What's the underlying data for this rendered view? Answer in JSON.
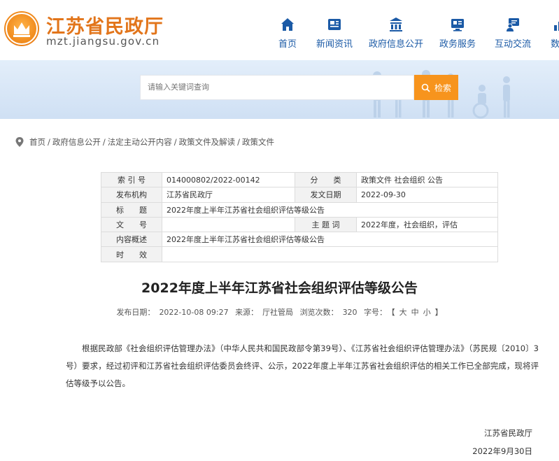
{
  "site": {
    "name": "江苏省民政厅",
    "url": "mzt.jiangsu.gov.cn"
  },
  "nav": [
    {
      "label": "首页",
      "icon": "home-icon"
    },
    {
      "label": "新闻资讯",
      "icon": "news-icon"
    },
    {
      "label": "政府信息公开",
      "icon": "building-icon"
    },
    {
      "label": "政务服务",
      "icon": "service-icon"
    },
    {
      "label": "互动交流",
      "icon": "chat-icon"
    },
    {
      "label": "数据",
      "icon": "data-icon"
    }
  ],
  "search": {
    "placeholder": "请输入关键词查询",
    "button_label": "检索"
  },
  "breadcrumb": [
    "首页",
    "政府信息公开",
    "法定主动公开内容",
    "政策文件及解读",
    "政策文件"
  ],
  "info": {
    "index_no_label": "索 引 号",
    "index_no": "014000802/2022-00142",
    "category_label": "分　　类",
    "category": "政策文件 社会组织 公告",
    "publisher_label": "发布机构",
    "publisher": "江苏省民政厅",
    "issue_date_label": "发文日期",
    "issue_date": "2022-09-30",
    "title_label": "标　　题",
    "title": "2022年度上半年江苏省社会组织评估等级公告",
    "doc_no_label": "文　　号",
    "doc_no": "",
    "keywords_label": "主 题 词",
    "keywords": "2022年度，社会组织，评估",
    "summary_label": "内容概述",
    "summary": "2022年度上半年江苏省社会组织评估等级公告",
    "validity_label": "时　　效",
    "validity": ""
  },
  "article": {
    "title": "2022年度上半年江苏省社会组织评估等级公告",
    "publish_label": "发布日期：",
    "publish_date": "2022-10-08 09:27",
    "source_label": "来源：",
    "source": "厅社管局",
    "views_label": "浏览次数：",
    "views": "320",
    "font_label": "字号：",
    "font_open": "【",
    "font_large": "大",
    "font_mid": "中",
    "font_small": "小",
    "font_close": "】",
    "body": "根据民政部《社会组织评估管理办法》（中华人民共和国民政部令第39号）、《江苏省社会组织评估管理办法》（苏民规〔2010〕3号）要求，经过初评和江苏省社会组织评估委员会终评、公示，2022年度上半年江苏省社会组织评估的相关工作已全部完成，现将评估等级予以公告。",
    "sign_org": "江苏省民政厅",
    "sign_date": "2022年9月30日"
  },
  "colors": {
    "brand_orange": "#e2751b",
    "nav_blue": "#1b5aa6",
    "search_btn": "#f7941d",
    "banner_bg": "#d8e7f7"
  }
}
